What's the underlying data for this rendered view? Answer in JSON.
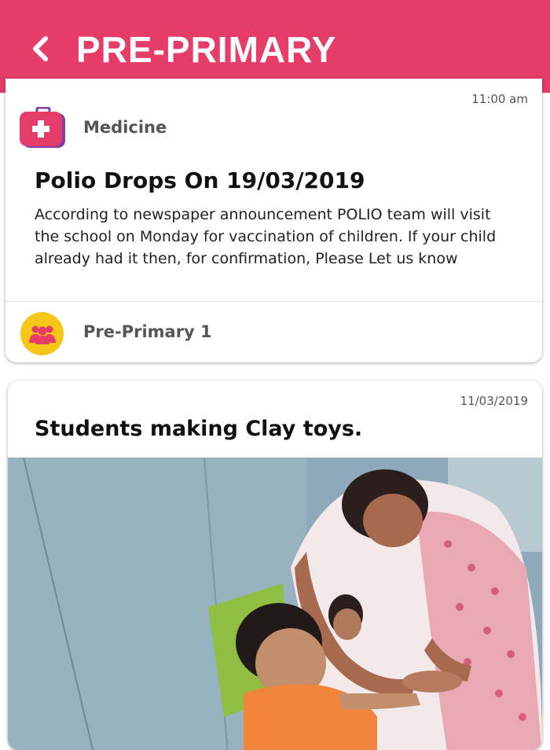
{
  "header": {
    "title": "PRE-PRIMARY"
  },
  "posts": [
    {
      "time": "11:00 am",
      "category": "Medicine",
      "title": "Polio Drops On 19/03/2019",
      "body": "According to newspaper announcement POLIO team will visit the school on Monday for vaccination of children. If your child already had it then, for confirmation, Please Let us know",
      "group": "Pre-Primary 1"
    },
    {
      "date": "11/03/2019",
      "title": "Students making Clay toys."
    }
  ],
  "colors": {
    "header": "#e53d68",
    "medicine_icon": "#e53d68",
    "group_icon": "#f5c518",
    "group_people": "#e53d68"
  }
}
